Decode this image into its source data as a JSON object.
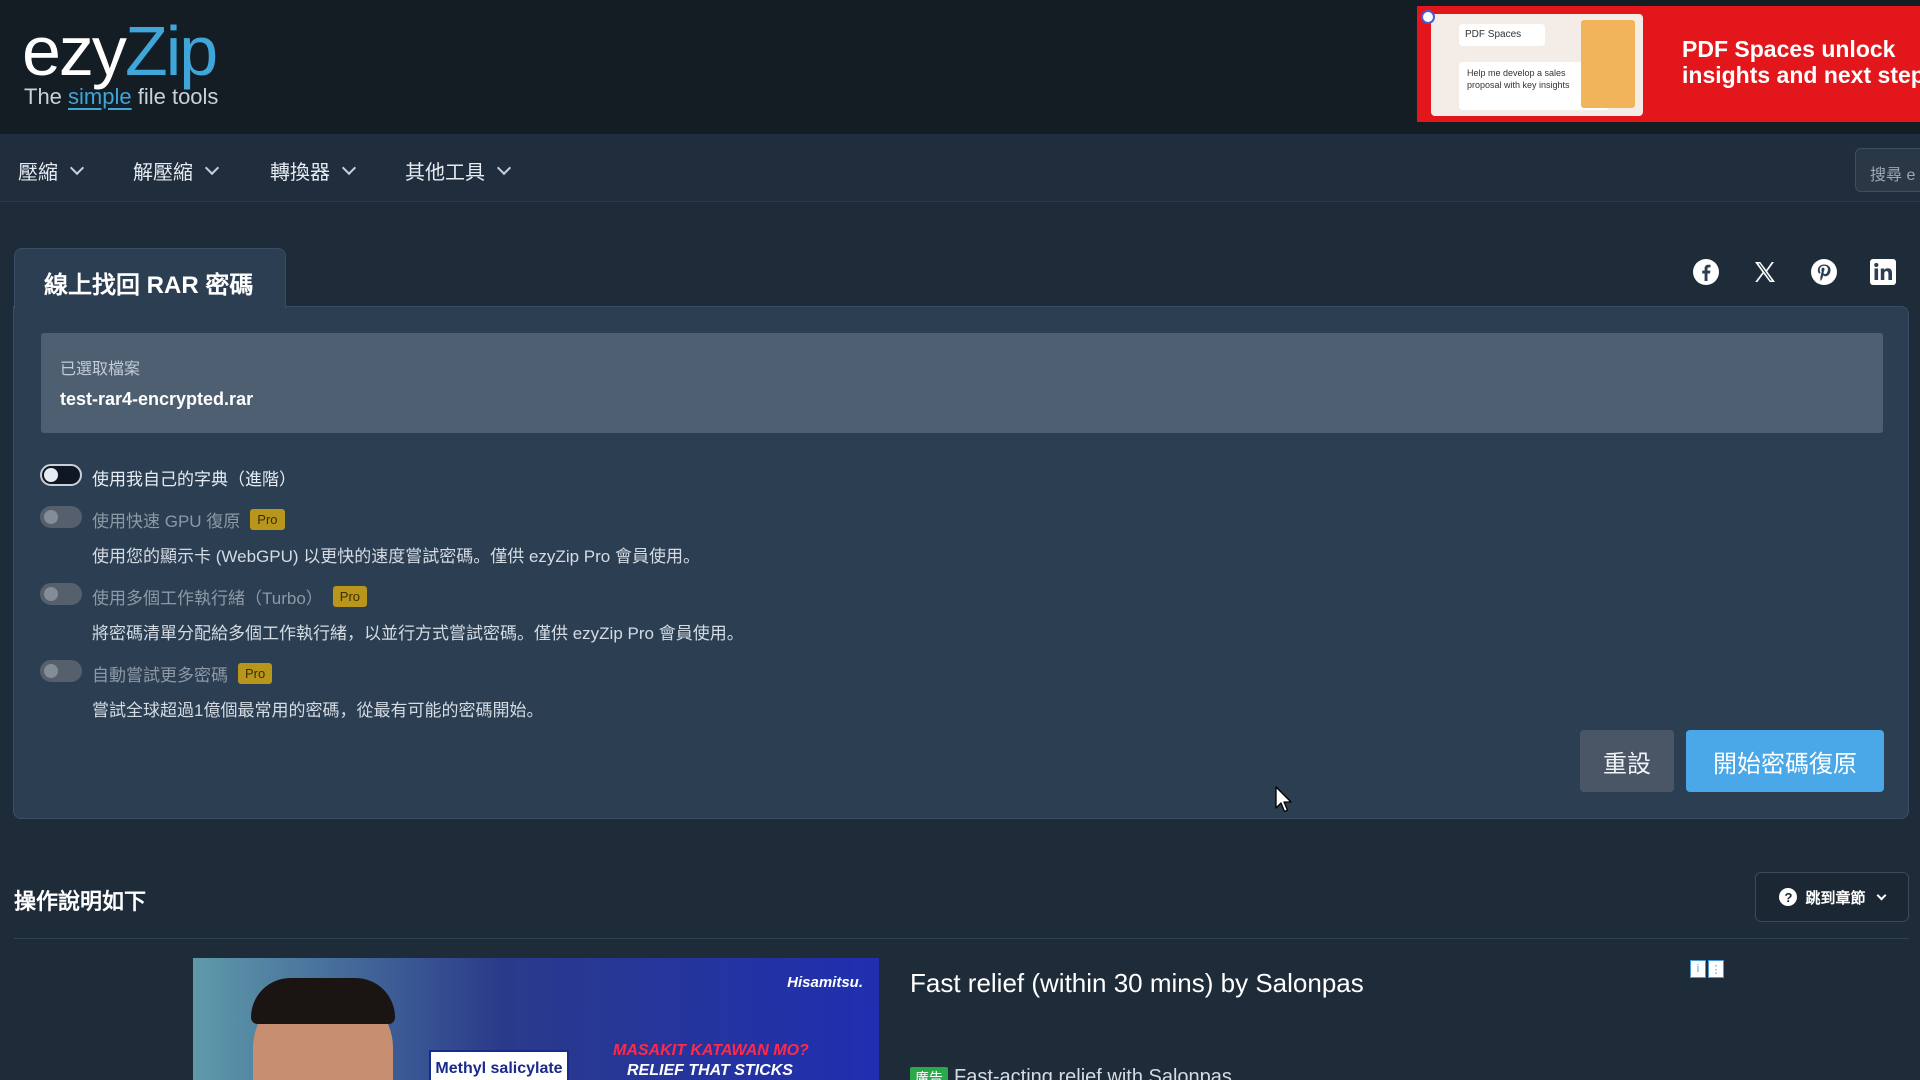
{
  "header": {
    "logo": {
      "brand_left": "ezy",
      "brand_right": "Zip",
      "tagline_before": "The ",
      "tagline_highlight": "simple",
      "tagline_after": " file tools"
    },
    "ad_banner": {
      "text_line1": "PDF Spaces unlock",
      "text_line2": "insights and next step",
      "card_title": "PDF Spaces",
      "card_body": "Help me develop a sales proposal with key insights"
    }
  },
  "nav": {
    "items": [
      {
        "label": "壓縮"
      },
      {
        "label": "解壓縮"
      },
      {
        "label": "轉換器"
      },
      {
        "label": "其他工具"
      }
    ],
    "search_placeholder": "搜尋 e"
  },
  "tool": {
    "title": "線上找回 RAR 密碼",
    "file": {
      "label": "已選取檔案",
      "name": "test-rar4-encrypted.rar"
    },
    "options": [
      {
        "label": "使用我自己的字典（進階）",
        "pro": "",
        "description": "",
        "enabled": true
      },
      {
        "label": "使用快速 GPU 復原",
        "pro": "Pro",
        "description": "使用您的顯示卡 (WebGPU) 以更快的速度嘗試密碼。僅供 ezyZip Pro 會員使用。",
        "enabled": false
      },
      {
        "label": "使用多個工作執行緒（Turbo）",
        "pro": "Pro",
        "description": "將密碼清單分配給多個工作執行緒，以並行方式嘗試密碼。僅供 ezyZip Pro 會員使用。",
        "enabled": false
      },
      {
        "label": "自動嘗試更多密碼",
        "pro": "Pro",
        "description": "嘗試全球超過1億個最常用的密碼，從最有可能的密碼開始。",
        "enabled": false
      }
    ],
    "buttons": {
      "reset": "重設",
      "start": "開始密碼復原"
    }
  },
  "social": [
    "facebook-icon",
    "x-twitter-icon",
    "pinterest-icon",
    "linkedin-icon"
  ],
  "instructions": {
    "title": "操作說明如下",
    "jump_label": "跳到章節"
  },
  "bottom_ad": {
    "brand": "Hisamitsu.",
    "product_label": "Methyl salicylate",
    "headline1": "MASAKIT KATAWAN MO?",
    "headline2": "RELIEF THAT STICKS",
    "title": "Fast relief (within 30 mins) by Salonpas",
    "tag": "廣告",
    "subtitle": "Fast-acting relief with Salonpas"
  },
  "colors": {
    "accent": "#3ea6d8",
    "primary_button": "#4aa7e8",
    "pro_badge": "#b8961c",
    "panel": "#2c3e52",
    "background": "#1e2b39"
  }
}
